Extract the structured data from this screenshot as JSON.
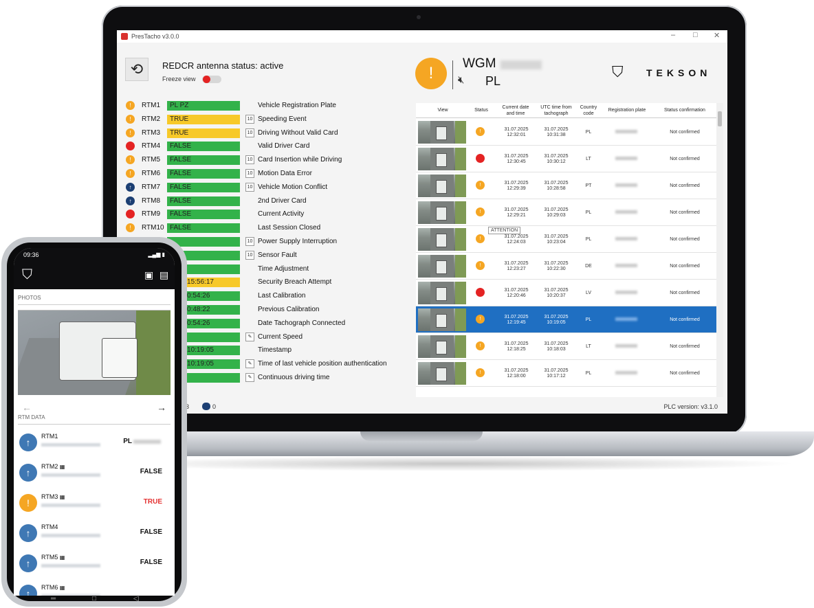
{
  "app": {
    "title": "PresTacho v3.0.0",
    "antenna_status": "REDCR antenna status: active",
    "freeze_label": "Freeze view",
    "vehicle_prefix": "WGM",
    "country": "PL",
    "brand": "TEKSON",
    "plc_version": "PLC version: v3.1.0",
    "counter_a": "3",
    "counter_b": "0",
    "tooltip": "ATTENTION"
  },
  "colors": {
    "green": "#33b24a",
    "yellow": "#f7c929",
    "orange": "#f5a623",
    "red": "#e42323",
    "blue": "#1c3f73",
    "selected_row": "#1f6fc2"
  },
  "rtm": [
    {
      "id": "RTM1",
      "value": "PL PZ",
      "box": "green",
      "status": "orange",
      "desc": "Vehicle Registration Plate",
      "icon": ""
    },
    {
      "id": "RTM2",
      "value": "TRUE",
      "box": "yellow",
      "status": "orange",
      "desc": "Speeding Event",
      "icon": "10"
    },
    {
      "id": "RTM3",
      "value": "TRUE",
      "box": "yellow",
      "status": "orange",
      "desc": "Driving Without Valid Card",
      "icon": "10"
    },
    {
      "id": "RTM4",
      "value": "FALSE",
      "box": "green",
      "status": "red",
      "desc": "Valid Driver Card",
      "icon": ""
    },
    {
      "id": "RTM5",
      "value": "FALSE",
      "box": "green",
      "status": "orange",
      "desc": "Card Insertion while Driving",
      "icon": "10"
    },
    {
      "id": "RTM6",
      "value": "FALSE",
      "box": "green",
      "status": "orange",
      "desc": "Motion Data Error",
      "icon": "10"
    },
    {
      "id": "RTM7",
      "value": "FALSE",
      "box": "green",
      "status": "blue",
      "desc": "Vehicle Motion Conflict",
      "icon": "10"
    },
    {
      "id": "RTM8",
      "value": "FALSE",
      "box": "green",
      "status": "blue",
      "desc": "2nd Driver Card",
      "icon": ""
    },
    {
      "id": "RTM9",
      "value": "FALSE",
      "box": "green",
      "status": "red",
      "desc": "Current Activity",
      "icon": ""
    },
    {
      "id": "RTM10",
      "value": "FALSE",
      "box": "green",
      "status": "orange",
      "desc": "Last Session Closed",
      "icon": ""
    },
    {
      "id": "",
      "value": "",
      "box": "green",
      "status": "",
      "desc": "Power Supply Interruption",
      "icon": "10"
    },
    {
      "id": "",
      "value": "nce",
      "box": "green",
      "status": "",
      "desc": "Sensor Fault",
      "icon": "10"
    },
    {
      "id": "",
      "value": "nce",
      "box": "green",
      "status": "",
      "desc": "Time Adjustment",
      "icon": ""
    },
    {
      "id": "",
      "value": "2025 15:56:17",
      "box": "yellow",
      "status": "",
      "desc": "Security Breach Attempt",
      "icon": ""
    },
    {
      "id": "",
      "value": "024 00:54:26",
      "box": "green",
      "status": "",
      "desc": "Last Calibration",
      "icon": ""
    },
    {
      "id": "",
      "value": "024 00:48:22",
      "box": "green",
      "status": "",
      "desc": "Previous Calibration",
      "icon": ""
    },
    {
      "id": "",
      "value": "024 00:54:26",
      "box": "green",
      "status": "",
      "desc": "Date Tachograph Connected",
      "icon": ""
    },
    {
      "id": "",
      "value": "",
      "box": "green",
      "status": "",
      "desc": "Current Speed",
      "icon": "✎"
    },
    {
      "id": "",
      "value": "2025 10:19:05",
      "box": "green",
      "status": "",
      "desc": "Timestamp",
      "icon": ""
    },
    {
      "id": "",
      "value": "2025 10:19:05",
      "box": "green",
      "status": "",
      "desc": "Time of last vehicle position authentication",
      "icon": "✎"
    },
    {
      "id": "",
      "value": "nin",
      "box": "green",
      "status": "",
      "desc": "Continuous driving time",
      "icon": "✎"
    }
  ],
  "table": {
    "headers": [
      "View",
      "Status",
      "Current date and time",
      "UTC time from tachograph",
      "Country code",
      "Registration plate",
      "Status confirmation"
    ],
    "rows": [
      {
        "status": "orange",
        "date": "31.07.2025",
        "time": "12:32:01",
        "utc_date": "31.07.2025",
        "utc_time": "10:31:38",
        "country": "PL",
        "confirm": "Not confirmed",
        "selected": false
      },
      {
        "status": "red",
        "date": "31.07.2025",
        "time": "12:30:45",
        "utc_date": "31.07.2025",
        "utc_time": "10:30:12",
        "country": "LT",
        "confirm": "Not confirmed",
        "selected": false
      },
      {
        "status": "orange",
        "date": "31.07.2025",
        "time": "12:29:39",
        "utc_date": "31.07.2025",
        "utc_time": "10:28:58",
        "country": "PT",
        "confirm": "Not confirmed",
        "selected": false
      },
      {
        "status": "orange",
        "date": "31.07.2025",
        "time": "12:29:21",
        "utc_date": "31.07.2025",
        "utc_time": "10:29:03",
        "country": "PL",
        "confirm": "Not confirmed",
        "selected": false
      },
      {
        "status": "orange",
        "date": "31.07.2025",
        "time": "12:24:03",
        "utc_date": "31.07.2025",
        "utc_time": "10:23:04",
        "country": "PL",
        "confirm": "Not confirmed",
        "selected": false
      },
      {
        "status": "orange",
        "date": "31.07.2025",
        "time": "12:23:27",
        "utc_date": "31.07.2025",
        "utc_time": "10:22:30",
        "country": "DE",
        "confirm": "Not confirmed",
        "selected": false
      },
      {
        "status": "red",
        "date": "31.07.2025",
        "time": "12:20:46",
        "utc_date": "31.07.2025",
        "utc_time": "10:20:37",
        "country": "LV",
        "confirm": "Not confirmed",
        "selected": false
      },
      {
        "status": "orange",
        "date": "31.07.2025",
        "time": "12:19:45",
        "utc_date": "31.07.2025",
        "utc_time": "10:19:05",
        "country": "PL",
        "confirm": "Not confirmed",
        "selected": true
      },
      {
        "status": "orange",
        "date": "31.07.2025",
        "time": "12:18:25",
        "utc_date": "31.07.2025",
        "utc_time": "10:18:03",
        "country": "LT",
        "confirm": "Not confirmed",
        "selected": false
      },
      {
        "status": "orange",
        "date": "31.07.2025",
        "time": "12:18:00",
        "utc_date": "31.07.2025",
        "utc_time": "10:17:12",
        "country": "PL",
        "confirm": "Not confirmed",
        "selected": false
      }
    ]
  },
  "phone": {
    "time": "09:36",
    "photos_label": "PHOTOS",
    "rtm_label": "RTM DATA",
    "items": [
      {
        "id": "RTM1",
        "calendar": false,
        "value": "PL",
        "value_color": "dark",
        "status": "blue"
      },
      {
        "id": "RTM2",
        "calendar": true,
        "value": "FALSE",
        "value_color": "dark",
        "status": "blue"
      },
      {
        "id": "RTM3",
        "calendar": true,
        "value": "TRUE",
        "value_color": "red",
        "status": "orange"
      },
      {
        "id": "RTM4",
        "calendar": false,
        "value": "FALSE",
        "value_color": "dark",
        "status": "blue"
      },
      {
        "id": "RTM5",
        "calendar": true,
        "value": "FALSE",
        "value_color": "dark",
        "status": "blue"
      },
      {
        "id": "RTM6",
        "calendar": true,
        "value": "",
        "value_color": "dark",
        "status": "blue"
      }
    ]
  }
}
